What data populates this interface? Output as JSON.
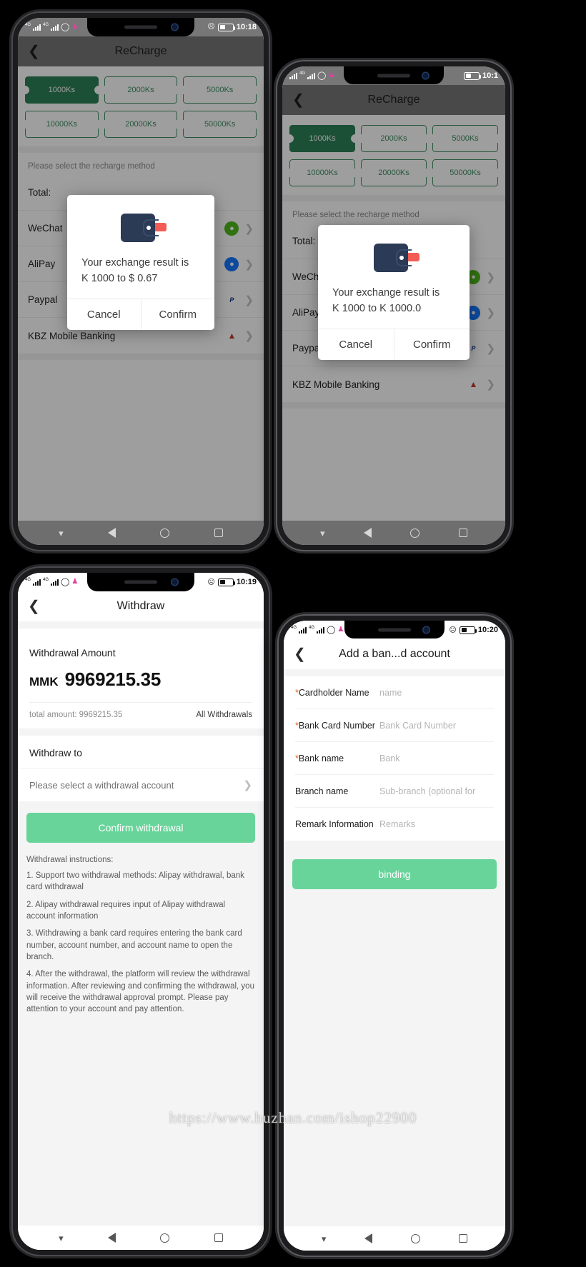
{
  "watermark": "https://www.huzhan.com/ishop22900",
  "phone1": {
    "status": {
      "clock": "10:18",
      "net_label": "4G",
      "wifi_icon": "wifi-icon",
      "person_icon": "person-icon"
    },
    "appbar": {
      "title": "ReCharge",
      "back_icon": "back-chevron-icon"
    },
    "coupons": [
      {
        "label": "1000Ks",
        "selected": true
      },
      {
        "label": "2000Ks",
        "selected": false
      },
      {
        "label": "5000Ks",
        "selected": false
      },
      {
        "label": "10000Ks",
        "selected": false
      },
      {
        "label": "20000Ks",
        "selected": false
      },
      {
        "label": "50000Ks",
        "selected": false
      }
    ],
    "hint": "Please select the recharge method",
    "total_label": "Total:",
    "pay_rows": [
      {
        "label": "WeChat",
        "icon": "wechat-icon",
        "icon_glyph": "✉"
      },
      {
        "label": "AliPay",
        "icon": "alipay-icon",
        "icon_glyph": "支"
      },
      {
        "label": "Paypal",
        "icon": "paypal-icon",
        "icon_glyph": "PP"
      },
      {
        "label": "KBZ Mobile Banking",
        "icon": "kbz-icon",
        "icon_glyph": "▲"
      }
    ],
    "dialog": {
      "icon": "wallet-icon",
      "message_line1": "Your exchange result is",
      "message_line2": "K 1000 to $ 0.67",
      "cancel": "Cancel",
      "confirm": "Confirm"
    },
    "navbar": {
      "chevron": "⌄",
      "back": "back-triangle-icon",
      "home": "home-circle-icon",
      "recents": "recents-square-icon"
    }
  },
  "phone2": {
    "status": {
      "clock": "10:1",
      "net_label": "4G"
    },
    "appbar": {
      "title": "ReCharge",
      "back_icon": "back-chevron-icon"
    },
    "coupons": [
      {
        "label": "1000Ks",
        "selected": true
      },
      {
        "label": "2000Ks",
        "selected": false
      },
      {
        "label": "5000Ks",
        "selected": false
      },
      {
        "label": "10000Ks",
        "selected": false
      },
      {
        "label": "20000Ks",
        "selected": false
      },
      {
        "label": "50000Ks",
        "selected": false
      }
    ],
    "hint": "Please select the recharge method",
    "total_label": "Total:",
    "pay_rows": [
      {
        "label": "WeChat",
        "icon": "wechat-icon",
        "icon_glyph": "✉"
      },
      {
        "label": "AliPay",
        "icon": "alipay-icon",
        "icon_glyph": "支"
      },
      {
        "label": "Paypal",
        "icon": "paypal-icon",
        "icon_glyph": "PP"
      },
      {
        "label": "KBZ Mobile Banking",
        "icon": "kbz-icon",
        "icon_glyph": "▲"
      }
    ],
    "dialog": {
      "icon": "wallet-icon",
      "message_line1": "Your exchange result is",
      "message_line2": "K 1000 to K 1000.0",
      "cancel": "Cancel",
      "confirm": "Confirm"
    }
  },
  "phone3": {
    "status": {
      "clock": "10:19",
      "net_label": "4G"
    },
    "appbar": {
      "title": "Withdraw",
      "back_icon": "back-chevron-icon"
    },
    "amount_section": {
      "heading": "Withdrawal Amount",
      "currency": "MMK",
      "value": "9969215.35",
      "total_text": "total amount: 9969215.35",
      "all_link": "All Withdrawals"
    },
    "withdraw_to": {
      "heading": "Withdraw to",
      "placeholder": "Please select a withdrawal account"
    },
    "confirm_button": "Confirm withdrawal",
    "instructions_title": "Withdrawal instructions:",
    "instructions": [
      "1. Support two withdrawal methods: Alipay withdrawal, bank card withdrawal",
      "2. Alipay withdrawal requires input of Alipay withdrawal account information",
      "3. Withdrawing a bank card requires entering the bank card number, account number, and account name to open the branch.",
      "4. After the withdrawal, the platform will review the withdrawal information. After reviewing and confirming the withdrawal, you will receive the withdrawal approval prompt. Please pay attention to your account and pay attention."
    ]
  },
  "phone4": {
    "status": {
      "clock": "10:20",
      "net_label": "4G"
    },
    "appbar": {
      "title": "Add a ban...d account",
      "back_icon": "back-chevron-icon"
    },
    "fields": [
      {
        "required": true,
        "label": "Cardholder Name",
        "placeholder": "name"
      },
      {
        "required": true,
        "label": "Bank Card Number",
        "placeholder": "Bank Card Number"
      },
      {
        "required": true,
        "label": "Bank name",
        "placeholder": "Bank"
      },
      {
        "required": false,
        "label": "Branch name",
        "placeholder": "Sub-branch (optional for"
      },
      {
        "required": false,
        "label": "Remark Information",
        "placeholder": "Remarks"
      }
    ],
    "binding_button": "binding"
  },
  "colors": {
    "accent_green": "#2e8158",
    "button_green": "#68d49a",
    "required_orange": "#e8622a",
    "wallet_navy": "#2b3a55",
    "wallet_card_red": "#f25c54"
  }
}
